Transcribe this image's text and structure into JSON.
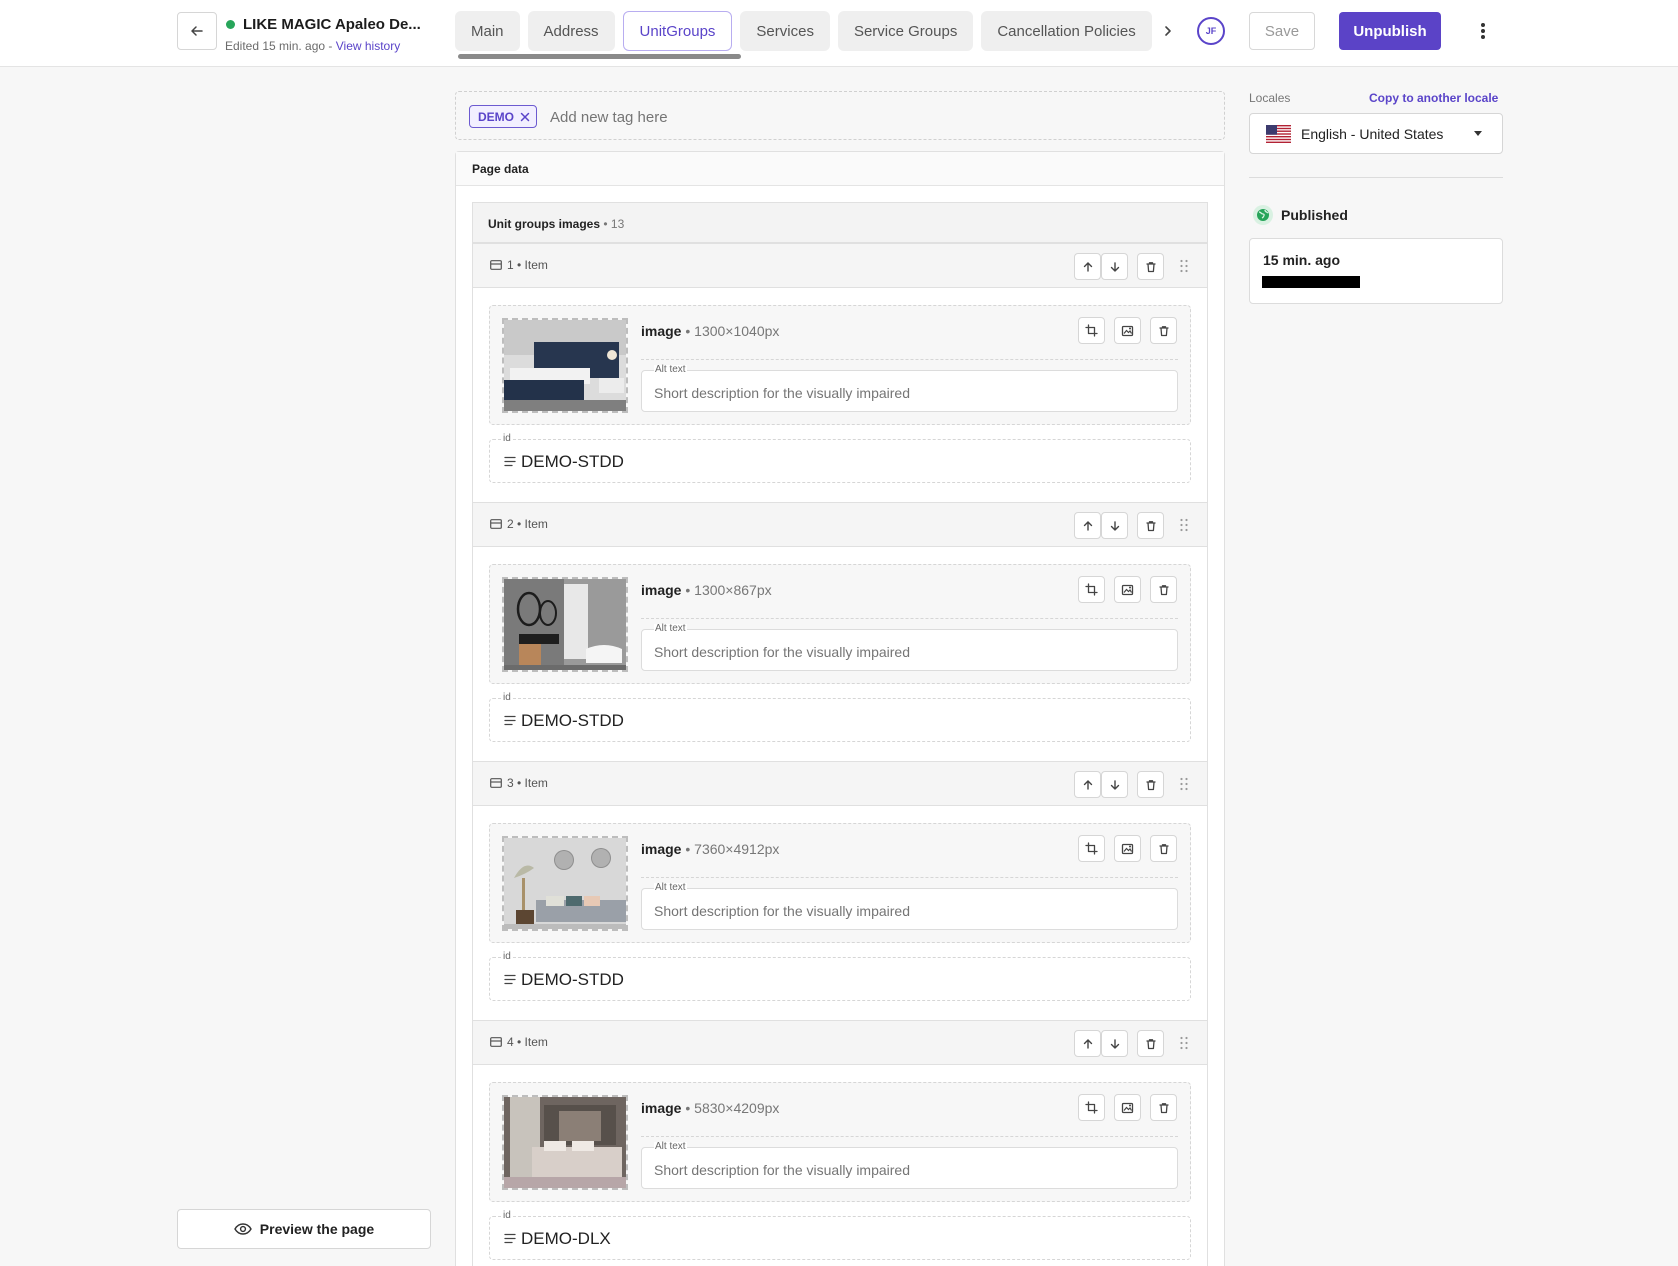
{
  "header": {
    "title": "LIKE MAGIC Apaleo De...",
    "edited": "Edited 15 min. ago",
    "edited_sep": " - ",
    "view_history": "View history",
    "tabs": [
      {
        "label": "Main"
      },
      {
        "label": "Address"
      },
      {
        "label": "UnitGroups"
      },
      {
        "label": "Services"
      },
      {
        "label": "Service Groups"
      },
      {
        "label": "Cancellation Policies"
      }
    ],
    "active_tab": "UnitGroups",
    "avatar_initials": "JF",
    "save_label": "Save",
    "unpublish_label": "Unpublish"
  },
  "tags": {
    "items": [
      {
        "label": "DEMO"
      }
    ],
    "placeholder": "Add new tag here"
  },
  "page_data": {
    "title": "Page data",
    "list": {
      "title": "Unit groups images",
      "count_sep": " • ",
      "count": "13",
      "alt_label": "Alt text",
      "alt_placeholder": "Short description for the visually impaired",
      "id_label": "id",
      "items": [
        {
          "label": "1 • Item",
          "image_label": "image",
          "dims": "1300×1040px",
          "id": "DEMO-STDD",
          "thumb": "bedroom-dark-headboard"
        },
        {
          "label": "2 • Item",
          "image_label": "image",
          "dims": "1300×867px",
          "id": "DEMO-STDD",
          "thumb": "bathroom"
        },
        {
          "label": "3 • Item",
          "image_label": "image",
          "dims": "7360×4912px",
          "id": "DEMO-STDD",
          "thumb": "living-room-sofa"
        },
        {
          "label": "4 • Item",
          "image_label": "image",
          "dims": "5830×4209px",
          "id": "DEMO-DLX",
          "thumb": "bedroom-deluxe"
        }
      ]
    }
  },
  "sidebar": {
    "locales_label": "Locales",
    "copy_locale": "Copy to another locale",
    "locale_value": "English - United States",
    "status_label": "Published",
    "status_time": "15 min. ago"
  },
  "preview_label": "Preview the page",
  "colors": {
    "accent": "#5b43c7",
    "published": "#27a55a"
  }
}
